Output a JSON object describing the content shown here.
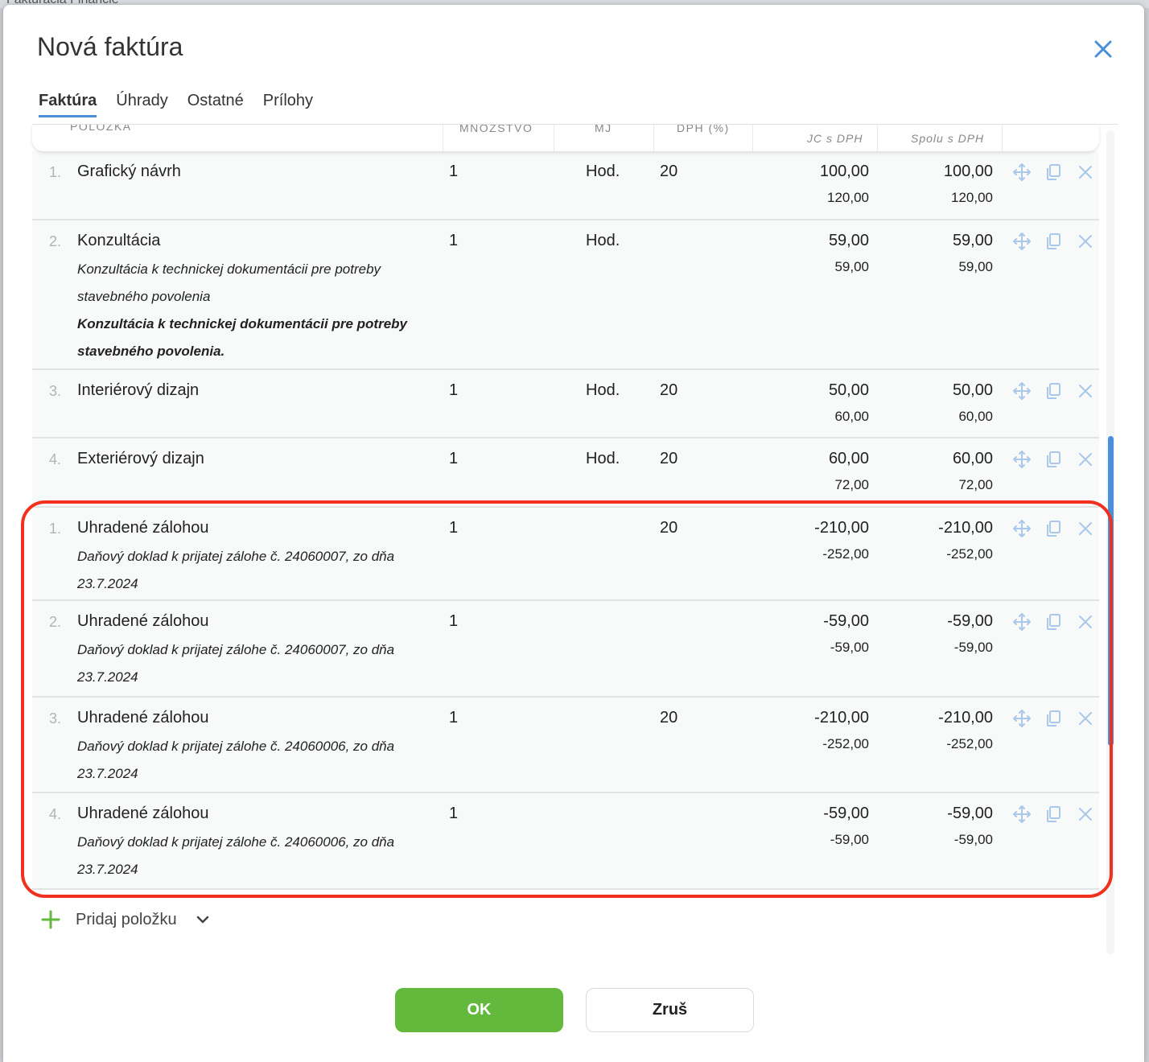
{
  "background": {
    "app_text": "Fakturácia   Financie"
  },
  "dialog": {
    "title": "Nová faktúra",
    "tabs": [
      {
        "label": "Faktúra",
        "active": true
      },
      {
        "label": "Úhrady",
        "active": false
      },
      {
        "label": "Ostatné",
        "active": false
      },
      {
        "label": "Prílohy",
        "active": false
      }
    ]
  },
  "table": {
    "headers": {
      "item": "POLOŽKA",
      "quantity": "MNOŽSTVO",
      "unit": "MJ",
      "vat": "DPH (%)",
      "unit_price": "JC s DPH",
      "total": "Spolu s DPH"
    },
    "rows": [
      {
        "num": "1.",
        "name": "Grafický návrh",
        "notes": [],
        "qty": "1",
        "unit": "Hod.",
        "vat": "20",
        "jc": "100,00",
        "jc_vat": "120,00",
        "total": "100,00",
        "total_vat": "120,00"
      },
      {
        "num": "2.",
        "name": "Konzultácia",
        "notes": [
          {
            "text": "Konzultácia k technickej dokumentácii pre potreby stavebného povolenia",
            "bold": false
          },
          {
            "text": "Konzultácia k technickej dokumentácii pre potreby stavebného povolenia.",
            "bold": true
          }
        ],
        "qty": "1",
        "unit": "Hod.",
        "vat": "",
        "jc": "59,00",
        "jc_vat": "59,00",
        "total": "59,00",
        "total_vat": "59,00"
      },
      {
        "num": "3.",
        "name": "Interiérový dizajn",
        "notes": [],
        "qty": "1",
        "unit": "Hod.",
        "vat": "20",
        "jc": "50,00",
        "jc_vat": "60,00",
        "total": "50,00",
        "total_vat": "60,00"
      },
      {
        "num": "4.",
        "name": "Exteriérový dizajn",
        "notes": [],
        "qty": "1",
        "unit": "Hod.",
        "vat": "20",
        "jc": "60,00",
        "jc_vat": "72,00",
        "total": "60,00",
        "total_vat": "72,00"
      },
      {
        "num": "1.",
        "name": "Uhradené zálohou",
        "notes": [
          {
            "text": "Daňový doklad k prijatej zálohe č. 24060007, zo dňa 23.7.2024",
            "bold": false
          }
        ],
        "qty": "1",
        "unit": "",
        "vat": "20",
        "jc": "-210,00",
        "jc_vat": "-252,00",
        "total": "-210,00",
        "total_vat": "-252,00"
      },
      {
        "num": "2.",
        "name": "Uhradené zálohou",
        "notes": [
          {
            "text": "Daňový doklad k prijatej zálohe č. 24060007, zo dňa 23.7.2024",
            "bold": false
          }
        ],
        "qty": "1",
        "unit": "",
        "vat": "",
        "jc": "-59,00",
        "jc_vat": "-59,00",
        "total": "-59,00",
        "total_vat": "-59,00"
      },
      {
        "num": "3.",
        "name": "Uhradené zálohou",
        "notes": [
          {
            "text": "Daňový doklad k prijatej zálohe č. 24060006, zo dňa 23.7.2024",
            "bold": false
          }
        ],
        "qty": "1",
        "unit": "",
        "vat": "20",
        "jc": "-210,00",
        "jc_vat": "-252,00",
        "total": "-210,00",
        "total_vat": "-252,00"
      },
      {
        "num": "4.",
        "name": "Uhradené zálohou",
        "notes": [
          {
            "text": "Daňový doklad k prijatej zálohe č. 24060006, zo dňa 23.7.2024",
            "bold": false
          }
        ],
        "qty": "1",
        "unit": "",
        "vat": "",
        "jc": "-59,00",
        "jc_vat": "-59,00",
        "total": "-59,00",
        "total_vat": "-59,00"
      }
    ],
    "row_icons": [
      "move-icon",
      "copy-icon",
      "delete-icon"
    ]
  },
  "add_item": {
    "label": "Pridaj položku",
    "icon": "plus-icon",
    "dropdown_icon": "chevron-down-icon"
  },
  "buttons": {
    "ok": "OK",
    "cancel": "Zruš"
  },
  "colors": {
    "accent": "#4a90d9",
    "ok_button": "#62b93b",
    "highlight": "#f2301e",
    "action_icons": "#a9c8ea"
  }
}
